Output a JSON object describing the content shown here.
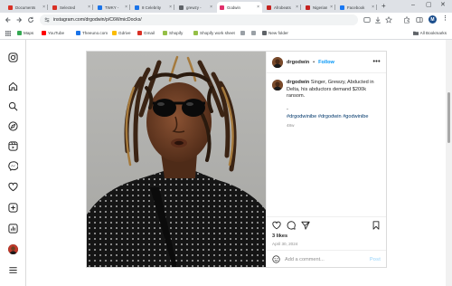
{
  "browser": {
    "tabs": [
      {
        "label": "Documents",
        "color": "#d93025"
      },
      {
        "label": "Selected",
        "color": "#d93025"
      },
      {
        "label": "TWKY - ",
        "color": "#1a73e8"
      },
      {
        "label": "8 Celebrity",
        "color": "#1a73e8"
      },
      {
        "label": "grewzy -",
        "color": "#5f6368"
      },
      {
        "label": "Godwin",
        "color": "#e1306c",
        "active": true
      },
      {
        "label": "Afrobeats",
        "color": "#c5221f"
      },
      {
        "label": "Nigerian",
        "color": "#c5221f"
      },
      {
        "label": "Facebook",
        "color": "#1877f2"
      }
    ],
    "url": "instagram.com/drgodwin/p/C6WmicDocks/",
    "profile_initial": "M",
    "bookmarks": [
      {
        "label": "Maps",
        "color": "#34a853"
      },
      {
        "label": "YouTube",
        "color": "#ff0000"
      },
      {
        "label": "Theeuno.com",
        "color": "#1a73e8"
      },
      {
        "label": "Gdrive",
        "color": "#fbbc04"
      },
      {
        "label": "Gmail",
        "color": "#d93025"
      },
      {
        "label": "Shopify",
        "color": "#95bf47"
      },
      {
        "label": "Shopify work sheet",
        "color": "#95bf47"
      },
      {
        "label": "",
        "color": "#9aa0a6"
      },
      {
        "label": "",
        "color": "#9aa0a6"
      },
      {
        "label": "New folder",
        "color": "#5f6368"
      }
    ],
    "all_bookmarks": "All Bookmarks"
  },
  "post": {
    "username": "drgodwin",
    "separator": "•",
    "follow": "Follow",
    "caption": "Singer, Grewzy, Abducted in Delta, his abductors demand $200k ransom.",
    "caption_dash": "-",
    "hashtags": "#drgodwinibe #drgodwin #godwinibe",
    "time_ago": "48w",
    "likes": "3 likes",
    "date": "April 30, 2024",
    "comment_placeholder": "Add a comment...",
    "post_button": "Post"
  }
}
